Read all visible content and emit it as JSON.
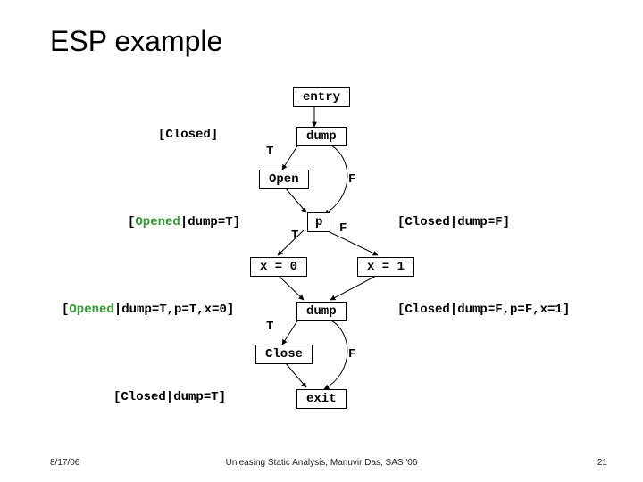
{
  "title": "ESP example",
  "nodes": {
    "entry": "entry",
    "dump1": "dump",
    "open": "Open",
    "p": "p",
    "x0": "x = 0",
    "x1": "x = 1",
    "dump2": "dump",
    "close": "Close",
    "exit": "exit"
  },
  "edges": {
    "t1": "T",
    "f1": "F",
    "t2": "T",
    "f2": "F",
    "t3": "T",
    "f3": "F"
  },
  "annotations": {
    "left1": "[Closed]",
    "left2": "[Opened|dump=T]",
    "left3_p1": "[Opened|",
    "left3_p2": "dump=T,p=T,x=0]",
    "left4_p1": "[Closed|",
    "left4_p2": "dump=T]",
    "right2": "[Closed|dump=F]",
    "right3_p1": "[Closed|",
    "right3_p2": "dump=F,p=F,x=1]"
  },
  "footer": {
    "date": "8/17/06",
    "credit": "Unleasing Static Analysis, Manuvir Das, SAS '06",
    "page": "21"
  }
}
